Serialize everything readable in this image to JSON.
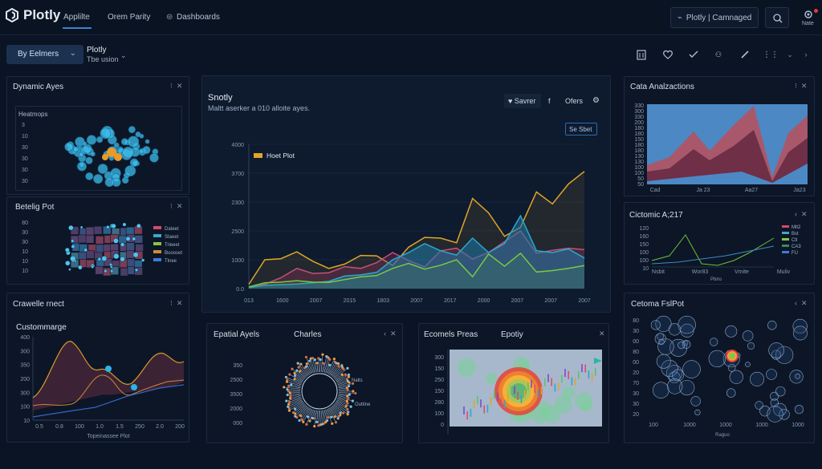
{
  "app": {
    "logo": "Plotly"
  },
  "nav": {
    "tabs": [
      "Applilte",
      "Orem Parity",
      "Dashboards"
    ],
    "cmd": "Plotly | Camnaged",
    "user": "Nate"
  },
  "toolbar": {
    "select_label": "By Eelmers",
    "project_title": "Plotly",
    "project_sub": "Tbe usion"
  },
  "panels": {
    "dynamic": {
      "title": "Dynamic Ayes",
      "sub": "Heatmops",
      "yticks": [
        "3",
        "10",
        "30",
        "30",
        "30",
        "30"
      ]
    },
    "bettling": {
      "title": "Betelig Pot",
      "yticks": [
        "80",
        "30",
        "30",
        "10",
        "10",
        "10"
      ],
      "legend": [
        "Dateet",
        "Staeet",
        "Trieeet",
        "Buooset",
        "Tlnee"
      ]
    },
    "crawlie": {
      "title": "Crawelle rnect",
      "sub": "Custommarge",
      "yticks": [
        "400",
        "300",
        "350",
        "200",
        "300",
        "100",
        "10"
      ],
      "xticks": [
        "0.5",
        "0.8",
        "100",
        "1.0",
        "1.5",
        "250",
        "2.0",
        "200"
      ],
      "xlabel": "Topeinassee Plot"
    },
    "main": {
      "title": "Snotly",
      "subtitle": "Maltt aserker a 010 alloite ayes.",
      "actions": [
        "Savrer",
        "f",
        "Ofers"
      ],
      "tag": "Se Sbet",
      "legend": "Hoet Plot"
    },
    "spatial": {
      "title": "Epatial Ayels",
      "sub": "Charles",
      "yticks": [
        "350",
        "2500",
        "3500",
        "2000",
        "000"
      ],
      "labels": [
        "Nalts",
        "Outtine"
      ]
    },
    "ecomets": {
      "title": "Ecomels Preas",
      "sub": "Epotiy",
      "yticks": [
        "300",
        "150",
        "250",
        "150",
        "280",
        "100",
        "0"
      ]
    },
    "cata": {
      "title": "Cata Analzactions",
      "yticks": [
        "330",
        "300",
        "330",
        "200",
        "180",
        "180",
        "150",
        "180",
        "180",
        "130",
        "130",
        "100",
        "100",
        "50",
        "50"
      ],
      "xticks": [
        "Cad",
        "Ja 23",
        "Aa27",
        "Ja23"
      ]
    },
    "ciomic": {
      "title": "Cictomic A;217",
      "yticks": [
        "120",
        "160",
        "150",
        "100",
        "100",
        "10"
      ],
      "legend": [
        "Mlt2",
        "Bst",
        "Ctl",
        "CA3",
        "FU"
      ],
      "xticks": [
        "Nsbit",
        "Wor83",
        "Vmite",
        "Muliv"
      ],
      "xlabel": "Pbiro"
    },
    "cetoma": {
      "title": "Cetoma FslPot",
      "yticks": [
        "80",
        "30",
        "00",
        "80",
        "00",
        "20",
        "70",
        "30",
        "30",
        "20"
      ],
      "xticks": [
        "100",
        "1000",
        "1000",
        "1000",
        "1000"
      ],
      "xlabel": "Raguo"
    }
  },
  "chart_data": {
    "type": "line",
    "title": "Snotly",
    "x": [
      "013",
      "1600",
      "2007",
      "2015",
      "1803",
      "2007",
      "2017",
      "2000",
      "2007",
      "2007",
      "2007"
    ],
    "yticks": [
      "4000",
      "3700",
      "2300",
      "2500",
      "1000",
      "0.0"
    ],
    "ylim": [
      0,
      4000
    ],
    "series": [
      {
        "name": "Hoet Plot",
        "color": "#e0a52a",
        "values": [
          120,
          800,
          830,
          1020,
          760,
          560,
          680,
          920,
          910,
          640,
          1150,
          1420,
          1400,
          1270,
          2500,
          2100,
          1450,
          1700,
          2680,
          2350,
          2900,
          3250
        ]
      },
      {
        "color": "#2aa8d0",
        "values": [
          30,
          90,
          110,
          130,
          160,
          200,
          350,
          380,
          450,
          800,
          1000,
          1250,
          1050,
          930,
          1400,
          1000,
          1250,
          2020,
          1050,
          1000,
          1100,
          850
        ]
      },
      {
        "color": "#7ac943",
        "values": [
          50,
          160,
          180,
          220,
          180,
          170,
          250,
          330,
          360,
          560,
          700,
          540,
          650,
          800,
          330,
          960,
          620,
          980,
          460,
          500,
          560,
          640
        ]
      },
      {
        "color": "#c0527a",
        "values": [
          40,
          120,
          300,
          560,
          420,
          440,
          610,
          560,
          720,
          1000,
          780,
          600,
          1050,
          1120,
          820,
          1000,
          1300,
          1600,
          980,
          1060,
          1120,
          1080
        ]
      }
    ]
  }
}
